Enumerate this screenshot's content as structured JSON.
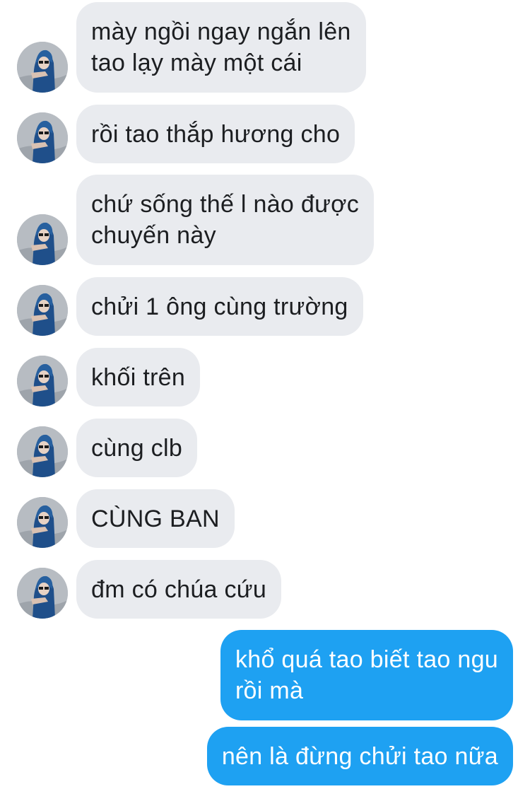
{
  "conversation": {
    "messages": [
      {
        "direction": "incoming",
        "text": "mày ngồi ngay ngắn lên\ntao lạy mày một cái",
        "avatar_icon": "contact-avatar-photo"
      },
      {
        "direction": "incoming",
        "text": "rồi tao thắp hương cho",
        "avatar_icon": "contact-avatar-photo"
      },
      {
        "direction": "incoming",
        "text": "chứ sống thế l nào được\nchuyến này",
        "avatar_icon": "contact-avatar-photo"
      },
      {
        "direction": "incoming",
        "text": "chửi 1 ông cùng trường",
        "avatar_icon": "contact-avatar-photo"
      },
      {
        "direction": "incoming",
        "text": "khối trên",
        "avatar_icon": "contact-avatar-photo"
      },
      {
        "direction": "incoming",
        "text": "cùng clb",
        "avatar_icon": "contact-avatar-photo"
      },
      {
        "direction": "incoming",
        "text": "CÙNG BAN",
        "avatar_icon": "contact-avatar-photo"
      },
      {
        "direction": "incoming",
        "text": "đm có chúa cứu",
        "avatar_icon": "contact-avatar-photo"
      },
      {
        "direction": "outgoing",
        "text": "khổ quá tao biết tao ngu\nrồi mà"
      },
      {
        "direction": "outgoing",
        "text": "nên là đừng chửi tao nữa"
      }
    ]
  },
  "colors": {
    "incoming_bubble": "#e9ebef",
    "incoming_text": "#1c1e21",
    "outgoing_bubble": "#1ea1f2",
    "outgoing_text": "#ffffff",
    "background": "#ffffff"
  }
}
